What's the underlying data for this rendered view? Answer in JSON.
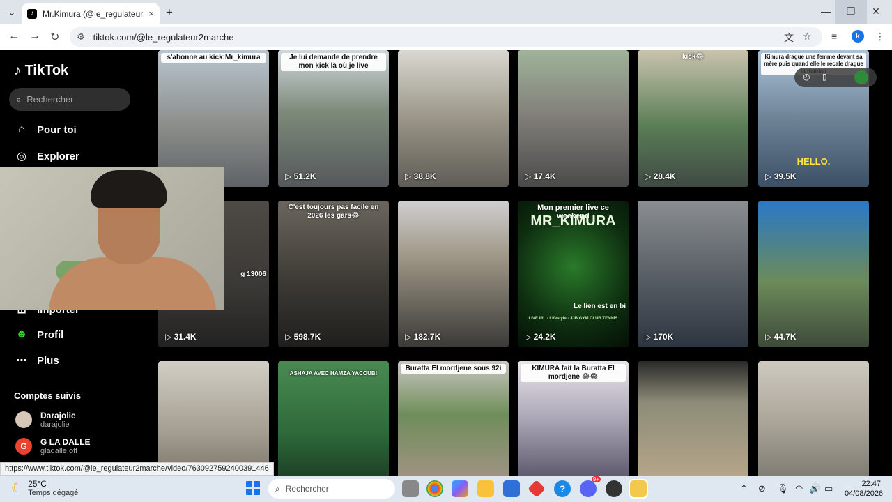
{
  "browser": {
    "tab_title": "Mr.Kimura (@le_regulateur2marche",
    "url": "tiktok.com/@le_regulateur2marche",
    "new_tab": "+",
    "close_tab": "×",
    "profile_initial": "k"
  },
  "sidebar": {
    "logo": "TikTok",
    "search_placeholder": "Rechercher",
    "items": [
      {
        "label": "Pour toi",
        "icon": "home-icon"
      },
      {
        "label": "Explorer",
        "icon": "compass-icon"
      },
      {
        "label": "Importer",
        "icon": "upload-icon"
      },
      {
        "label": "Profil",
        "icon": "profile-icon"
      },
      {
        "label": "Plus",
        "icon": "more-icon"
      }
    ],
    "following_header": "Comptes suivis",
    "accounts": [
      {
        "name": "Darajolie",
        "handle": "darajolie"
      },
      {
        "name": "G LA DALLE",
        "handle": "gladalle.off"
      }
    ]
  },
  "videos": [
    {
      "views": "",
      "caption": "s'abonne au kick:Mr_kimura"
    },
    {
      "views": "51.2K",
      "caption": "Je lui demande de prendre mon kick là où je live"
    },
    {
      "views": "38.8K",
      "caption": ""
    },
    {
      "views": "17.4K",
      "caption": ""
    },
    {
      "views": "28.4K",
      "caption": "kick😂"
    },
    {
      "views": "39.5K",
      "caption": "Kimura drague une femme devant sa mère puis quand elle le recale drague la maman",
      "overlay": "HELLO."
    },
    {
      "views": "31.4K",
      "caption": "g 13006"
    },
    {
      "views": "598.7K",
      "caption": "C'est toujours pas facile en 2026 les gars😂"
    },
    {
      "views": "182.7K",
      "caption": ""
    },
    {
      "views": "24.2K",
      "caption": "Mon premier live ce weekend",
      "big": "MR_KIMURA",
      "sub": "Le lien est en bi",
      "small": "LIVE IRL · Lifestyle · JJB GYM CLUB TENNIS"
    },
    {
      "views": "170K",
      "caption": ""
    },
    {
      "views": "44.7K",
      "caption": ""
    },
    {
      "views": "",
      "caption": ""
    },
    {
      "views": "",
      "caption": "ASHAJA AVEC HAMZA YACOUB!"
    },
    {
      "views": "",
      "caption": "Buratta El mordjene sous 92i"
    },
    {
      "views": "",
      "caption": "KIMURA fait la Buratta El mordjene 😂😂"
    },
    {
      "views": "",
      "caption": ""
    },
    {
      "views": "",
      "caption": ""
    }
  ],
  "status_url": "https://www.tiktok.com/@le_regulateur2marche/video/7630927592400391446",
  "taskbar": {
    "temp": "25°C",
    "weather": "Temps dégagé",
    "search_placeholder": "Rechercher",
    "time": "22:47",
    "date": "04/08/2026",
    "badge": "9+"
  },
  "colors": {
    "accent": "#1a73e8",
    "tiktok_bg": "#000000"
  }
}
